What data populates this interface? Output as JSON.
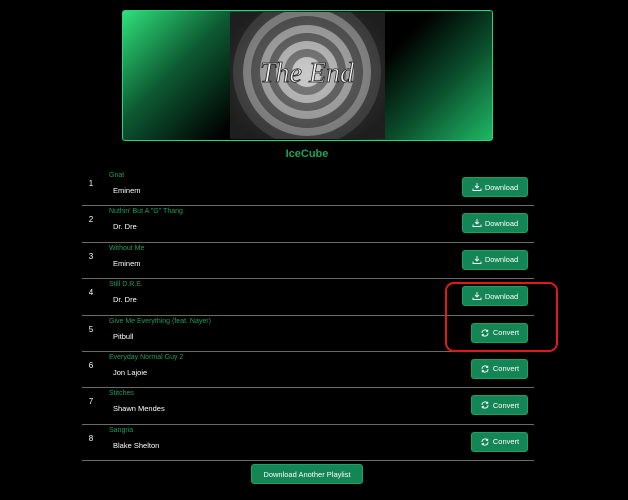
{
  "playlist": {
    "name": "IceCube",
    "cover_text": "The End"
  },
  "labels": {
    "download": "Download",
    "convert": "Convert",
    "download_another": "Download Another Playlist"
  },
  "tracks": [
    {
      "number": "1",
      "title": "Gnat",
      "artist": "Eminem",
      "action": "download"
    },
    {
      "number": "2",
      "title": "Nuthin' But A \"G\" Thang",
      "artist": "Dr. Dre",
      "action": "download"
    },
    {
      "number": "3",
      "title": "Without Me",
      "artist": "Eminem",
      "action": "download"
    },
    {
      "number": "4",
      "title": "Still D.R.E.",
      "artist": "Dr. Dre",
      "action": "download"
    },
    {
      "number": "5",
      "title": "Give Me Everything (feat. Nayer)",
      "artist": "Pitbull",
      "action": "convert"
    },
    {
      "number": "6",
      "title": "Everyday Normal Guy 2",
      "artist": "Jon Lajoie",
      "action": "convert"
    },
    {
      "number": "7",
      "title": "Stitches",
      "artist": "Shawn Mendes",
      "action": "convert"
    },
    {
      "number": "8",
      "title": "Sangria",
      "artist": "Blake Shelton",
      "action": "convert"
    }
  ],
  "colors": {
    "accent": "#148554",
    "title_green": "#1e9c5a",
    "highlight_red": "#e0191a",
    "background": "#000000"
  },
  "icons": {
    "download": "download-icon",
    "convert": "sync-icon"
  }
}
